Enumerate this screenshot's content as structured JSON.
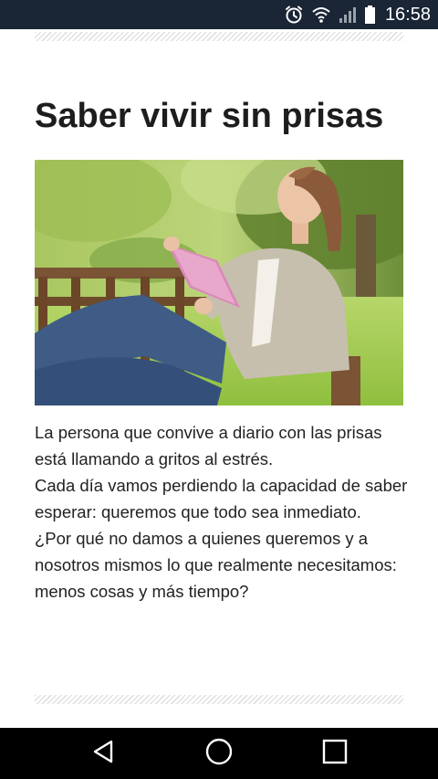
{
  "status_bar": {
    "time": "16:58",
    "icons": [
      "alarm-icon",
      "wifi-icon",
      "signal-icon",
      "battery-icon"
    ],
    "background": "#1a2535"
  },
  "article": {
    "title": "Saber vivir sin prisas",
    "image_alt": "woman-reading-book-on-park-bench",
    "paragraphs": [
      "La persona que convive a diario con las prisas está llamando a gritos al estrés.",
      "Cada día vamos perdiendo la capacidad de saber esperar: queremos que todo sea inmediato.",
      "¿Por qué no damos a quienes queremos y a nosotros mismos lo que realmente necesitamos: menos cosas y más tiempo?"
    ]
  },
  "nav_bar": {
    "buttons": [
      "back-icon",
      "home-icon",
      "recents-icon"
    ],
    "background": "#000000"
  }
}
